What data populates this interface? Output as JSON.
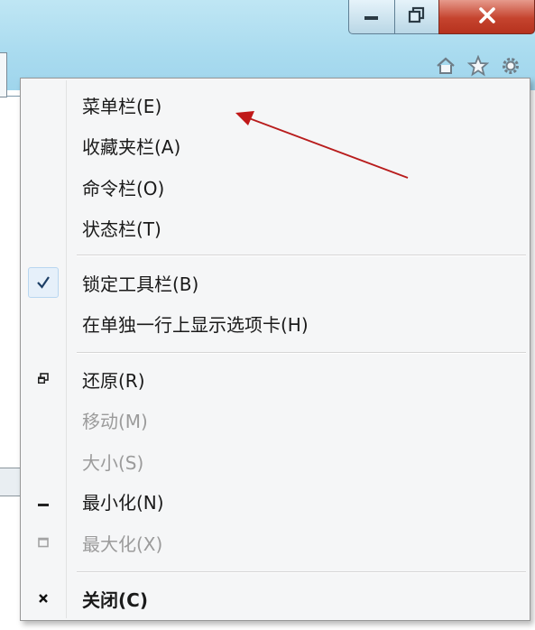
{
  "window": {
    "minimize_icon": "minimize-icon",
    "restore_icon": "restore-icon",
    "close_icon": "close-icon",
    "toolbar_icons": [
      "home-icon",
      "star-icon",
      "gear-icon"
    ],
    "titlebar_color": "#a9dbef",
    "close_color": "#c5432e"
  },
  "menu": {
    "groups": [
      [
        {
          "label": "菜单栏(E)",
          "enabled": true
        },
        {
          "label": "收藏夹栏(A)",
          "enabled": true
        },
        {
          "label": "命令栏(O)",
          "enabled": true
        },
        {
          "label": "状态栏(T)",
          "enabled": true
        }
      ],
      [
        {
          "label": "锁定工具栏(B)",
          "enabled": true,
          "checked": true,
          "icon": "checkmark-icon"
        },
        {
          "label": "在单独一行上显示选项卡(H)",
          "enabled": true
        }
      ],
      [
        {
          "label": "还原(R)",
          "enabled": true,
          "icon": "restore-icon"
        },
        {
          "label": "移动(M)",
          "enabled": false
        },
        {
          "label": "大小(S)",
          "enabled": false
        },
        {
          "label": "最小化(N)",
          "enabled": true,
          "icon": "minimize-icon"
        },
        {
          "label": "最大化(X)",
          "enabled": false,
          "icon": "maximize-icon"
        }
      ],
      [
        {
          "label": "关闭(C)",
          "enabled": true,
          "bold": true,
          "icon": "close-icon"
        }
      ]
    ]
  },
  "annotation": {
    "arrow_color": "#b81c1c",
    "points_to": "菜单栏(E)"
  }
}
